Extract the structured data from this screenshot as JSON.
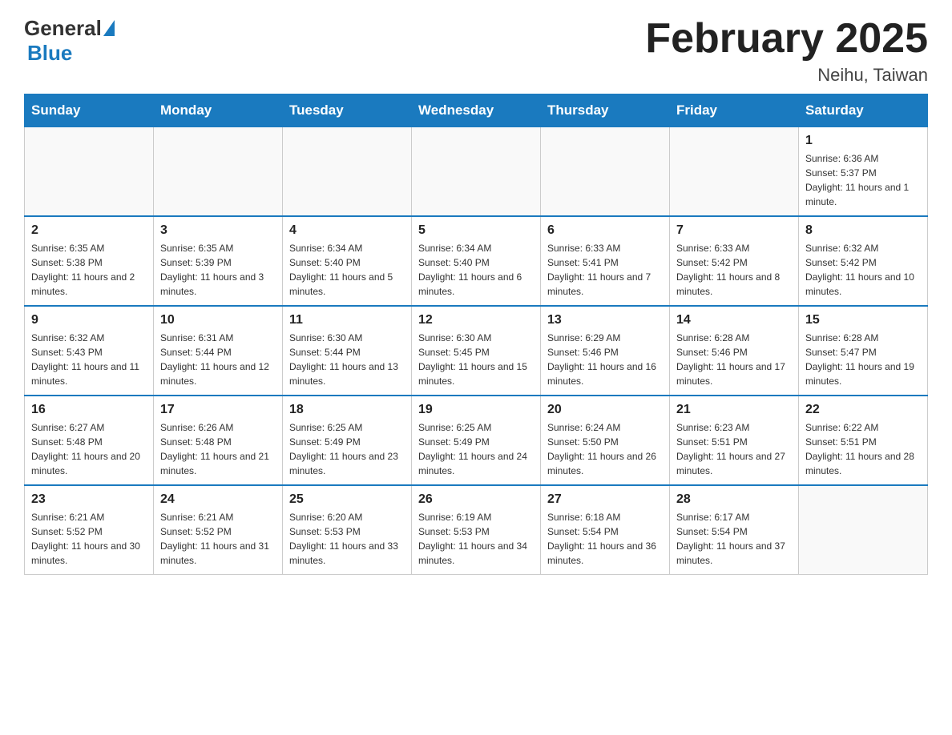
{
  "logo": {
    "text_general": "General",
    "text_blue": "Blue"
  },
  "header": {
    "title": "February 2025",
    "subtitle": "Neihu, Taiwan"
  },
  "days_of_week": [
    "Sunday",
    "Monday",
    "Tuesday",
    "Wednesday",
    "Thursday",
    "Friday",
    "Saturday"
  ],
  "weeks": [
    [
      {
        "day": "",
        "info": ""
      },
      {
        "day": "",
        "info": ""
      },
      {
        "day": "",
        "info": ""
      },
      {
        "day": "",
        "info": ""
      },
      {
        "day": "",
        "info": ""
      },
      {
        "day": "",
        "info": ""
      },
      {
        "day": "1",
        "info": "Sunrise: 6:36 AM\nSunset: 5:37 PM\nDaylight: 11 hours and 1 minute."
      }
    ],
    [
      {
        "day": "2",
        "info": "Sunrise: 6:35 AM\nSunset: 5:38 PM\nDaylight: 11 hours and 2 minutes."
      },
      {
        "day": "3",
        "info": "Sunrise: 6:35 AM\nSunset: 5:39 PM\nDaylight: 11 hours and 3 minutes."
      },
      {
        "day": "4",
        "info": "Sunrise: 6:34 AM\nSunset: 5:40 PM\nDaylight: 11 hours and 5 minutes."
      },
      {
        "day": "5",
        "info": "Sunrise: 6:34 AM\nSunset: 5:40 PM\nDaylight: 11 hours and 6 minutes."
      },
      {
        "day": "6",
        "info": "Sunrise: 6:33 AM\nSunset: 5:41 PM\nDaylight: 11 hours and 7 minutes."
      },
      {
        "day": "7",
        "info": "Sunrise: 6:33 AM\nSunset: 5:42 PM\nDaylight: 11 hours and 8 minutes."
      },
      {
        "day": "8",
        "info": "Sunrise: 6:32 AM\nSunset: 5:42 PM\nDaylight: 11 hours and 10 minutes."
      }
    ],
    [
      {
        "day": "9",
        "info": "Sunrise: 6:32 AM\nSunset: 5:43 PM\nDaylight: 11 hours and 11 minutes."
      },
      {
        "day": "10",
        "info": "Sunrise: 6:31 AM\nSunset: 5:44 PM\nDaylight: 11 hours and 12 minutes."
      },
      {
        "day": "11",
        "info": "Sunrise: 6:30 AM\nSunset: 5:44 PM\nDaylight: 11 hours and 13 minutes."
      },
      {
        "day": "12",
        "info": "Sunrise: 6:30 AM\nSunset: 5:45 PM\nDaylight: 11 hours and 15 minutes."
      },
      {
        "day": "13",
        "info": "Sunrise: 6:29 AM\nSunset: 5:46 PM\nDaylight: 11 hours and 16 minutes."
      },
      {
        "day": "14",
        "info": "Sunrise: 6:28 AM\nSunset: 5:46 PM\nDaylight: 11 hours and 17 minutes."
      },
      {
        "day": "15",
        "info": "Sunrise: 6:28 AM\nSunset: 5:47 PM\nDaylight: 11 hours and 19 minutes."
      }
    ],
    [
      {
        "day": "16",
        "info": "Sunrise: 6:27 AM\nSunset: 5:48 PM\nDaylight: 11 hours and 20 minutes."
      },
      {
        "day": "17",
        "info": "Sunrise: 6:26 AM\nSunset: 5:48 PM\nDaylight: 11 hours and 21 minutes."
      },
      {
        "day": "18",
        "info": "Sunrise: 6:25 AM\nSunset: 5:49 PM\nDaylight: 11 hours and 23 minutes."
      },
      {
        "day": "19",
        "info": "Sunrise: 6:25 AM\nSunset: 5:49 PM\nDaylight: 11 hours and 24 minutes."
      },
      {
        "day": "20",
        "info": "Sunrise: 6:24 AM\nSunset: 5:50 PM\nDaylight: 11 hours and 26 minutes."
      },
      {
        "day": "21",
        "info": "Sunrise: 6:23 AM\nSunset: 5:51 PM\nDaylight: 11 hours and 27 minutes."
      },
      {
        "day": "22",
        "info": "Sunrise: 6:22 AM\nSunset: 5:51 PM\nDaylight: 11 hours and 28 minutes."
      }
    ],
    [
      {
        "day": "23",
        "info": "Sunrise: 6:21 AM\nSunset: 5:52 PM\nDaylight: 11 hours and 30 minutes."
      },
      {
        "day": "24",
        "info": "Sunrise: 6:21 AM\nSunset: 5:52 PM\nDaylight: 11 hours and 31 minutes."
      },
      {
        "day": "25",
        "info": "Sunrise: 6:20 AM\nSunset: 5:53 PM\nDaylight: 11 hours and 33 minutes."
      },
      {
        "day": "26",
        "info": "Sunrise: 6:19 AM\nSunset: 5:53 PM\nDaylight: 11 hours and 34 minutes."
      },
      {
        "day": "27",
        "info": "Sunrise: 6:18 AM\nSunset: 5:54 PM\nDaylight: 11 hours and 36 minutes."
      },
      {
        "day": "28",
        "info": "Sunrise: 6:17 AM\nSunset: 5:54 PM\nDaylight: 11 hours and 37 minutes."
      },
      {
        "day": "",
        "info": ""
      }
    ]
  ]
}
